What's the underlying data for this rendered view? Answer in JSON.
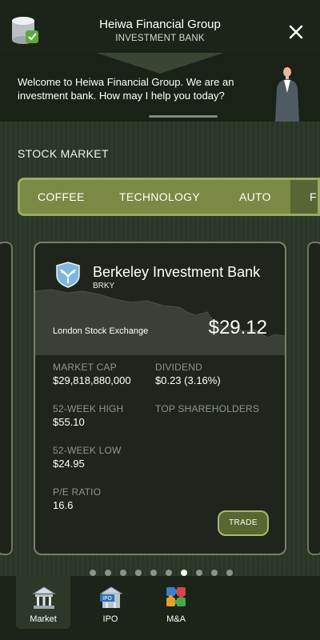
{
  "header": {
    "title": "Heiwa Financial Group",
    "subtitle": "INVESTMENT BANK",
    "logo_icon": "bank-tin-icon",
    "close_icon": "close-icon"
  },
  "welcome": {
    "message": "Welcome to Heiwa Financial Group. We are an investment bank. How may I help you today?"
  },
  "market": {
    "section_title": "STOCK MARKET",
    "tabs": [
      {
        "label": "COFFEE"
      },
      {
        "label": "TECHNOLOGY"
      },
      {
        "label": "AUTO"
      },
      {
        "label": "FI"
      }
    ],
    "active_tab_index": 3
  },
  "card": {
    "name": "Berkeley Investment Bank",
    "ticker": "BRKY",
    "exchange": "London Stock Exchange",
    "price": "$29.12",
    "stats": {
      "market_cap_label": "MARKET CAP",
      "market_cap_value": "$29,818,880,000",
      "dividend_label": "DIVIDEND",
      "dividend_value": "$0.23 (3.16%)",
      "high_label": "52-WEEK HIGH",
      "high_value": "$55.10",
      "shareholders_label": "TOP SHAREHOLDERS",
      "low_label": "52-WEEK LOW",
      "low_value": "$24.95",
      "pe_label": "P/E RATIO",
      "pe_value": "16.6"
    },
    "trade_label": "TRADE"
  },
  "pagination": {
    "count": 10,
    "active_index": 6
  },
  "bottom_nav": [
    {
      "label": "Market",
      "icon": "bank-building-icon",
      "active": true
    },
    {
      "label": "IPO",
      "icon": "ipo-building-icon",
      "active": false
    },
    {
      "label": "M&A",
      "icon": "puzzle-pieces-icon",
      "active": false
    }
  ],
  "colors": {
    "accent": "#9aa963",
    "tab_bg": "#7a8a44",
    "card_bg": "#1f241d",
    "page_bg": "#2b3726"
  }
}
